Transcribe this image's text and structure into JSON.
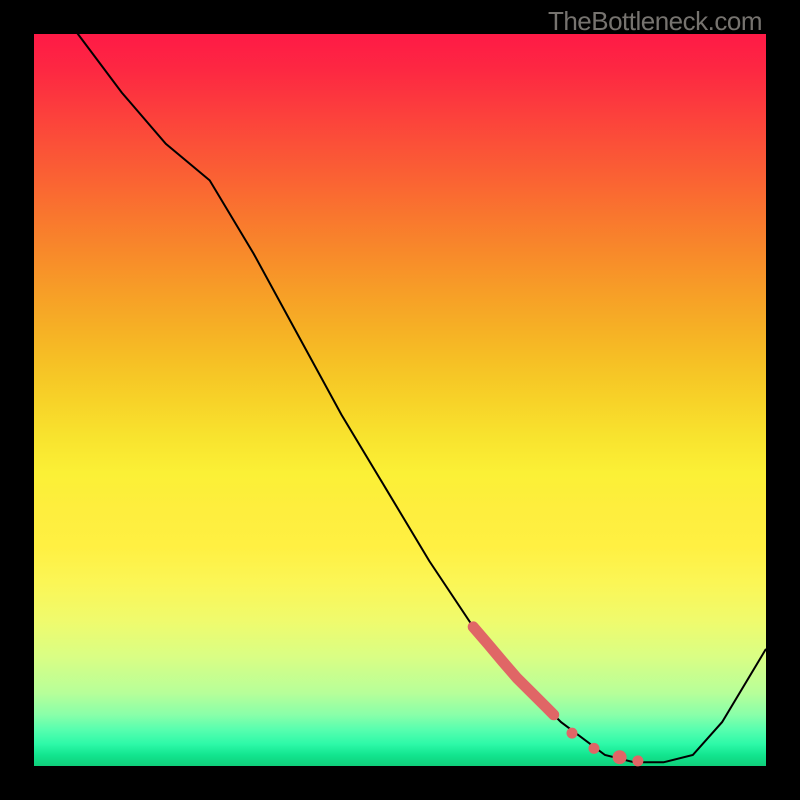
{
  "watermark": "TheBottleneck.com",
  "chart_data": {
    "type": "line",
    "title": "",
    "xlabel": "",
    "ylabel": "",
    "xlim": [
      0,
      100
    ],
    "ylim": [
      0,
      100
    ],
    "grid": false,
    "legend": false,
    "series": [
      {
        "name": "bottleneck-curve",
        "color": "#000000",
        "x": [
          0,
          6,
          12,
          18,
          24,
          30,
          36,
          42,
          48,
          54,
          60,
          66,
          72,
          78,
          82,
          86,
          90,
          94,
          100
        ],
        "y": [
          108,
          100,
          92,
          85,
          80,
          70,
          59,
          48,
          38,
          28,
          19,
          12,
          6,
          1.5,
          0.5,
          0.5,
          1.5,
          6,
          16
        ]
      }
    ],
    "highlight_segments": [
      {
        "name": "highlight-thick",
        "color": "#e06666",
        "width": 11,
        "x": [
          60,
          62,
          64,
          66,
          68,
          70,
          71
        ],
        "y": [
          19,
          16.7,
          14.3,
          12,
          10,
          8,
          7
        ]
      }
    ],
    "highlight_dots": [
      {
        "name": "dot-1",
        "x": 73.5,
        "y": 4.5,
        "r": 5.5,
        "color": "#e06666"
      },
      {
        "name": "dot-2",
        "x": 76.5,
        "y": 2.4,
        "r": 5.5,
        "color": "#e06666"
      },
      {
        "name": "dot-3",
        "x": 80.0,
        "y": 1.2,
        "r": 7.0,
        "color": "#e06666"
      },
      {
        "name": "dot-4",
        "x": 82.5,
        "y": 0.7,
        "r": 5.5,
        "color": "#e06666"
      }
    ],
    "background_gradient": {
      "top": "#fe1a46",
      "mid": "#f8e32e",
      "bottom": "#0fcf7a"
    }
  }
}
